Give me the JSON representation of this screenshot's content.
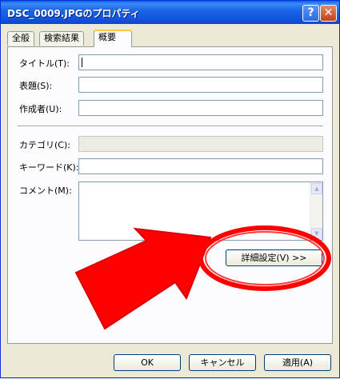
{
  "window": {
    "title": "DSC_0009.JPGのプロパティ"
  },
  "titlebar": {
    "help_label": "?",
    "close_label": "✕"
  },
  "tabs": [
    {
      "label": "全般",
      "active": false
    },
    {
      "label": "検索結果",
      "active": false
    },
    {
      "label": "概要",
      "active": true
    }
  ],
  "fields": {
    "title": {
      "label": "タイトル(T):",
      "value": ""
    },
    "subject": {
      "label": "表題(S):",
      "value": ""
    },
    "author": {
      "label": "作成者(U):",
      "value": ""
    },
    "category": {
      "label": "カテゴリ(C):",
      "value": ""
    },
    "keywords": {
      "label": "キーワード(K):",
      "value": ""
    },
    "comments": {
      "label": "コメント(M):",
      "value": ""
    }
  },
  "advanced_button": "詳細設定(V) >>",
  "footer": {
    "ok": "OK",
    "cancel": "キャンセル",
    "apply": "適用(A)"
  },
  "colors": {
    "titlebar": "#0a5ee6",
    "face": "#ece9d8",
    "annotation": "#ff0000"
  }
}
